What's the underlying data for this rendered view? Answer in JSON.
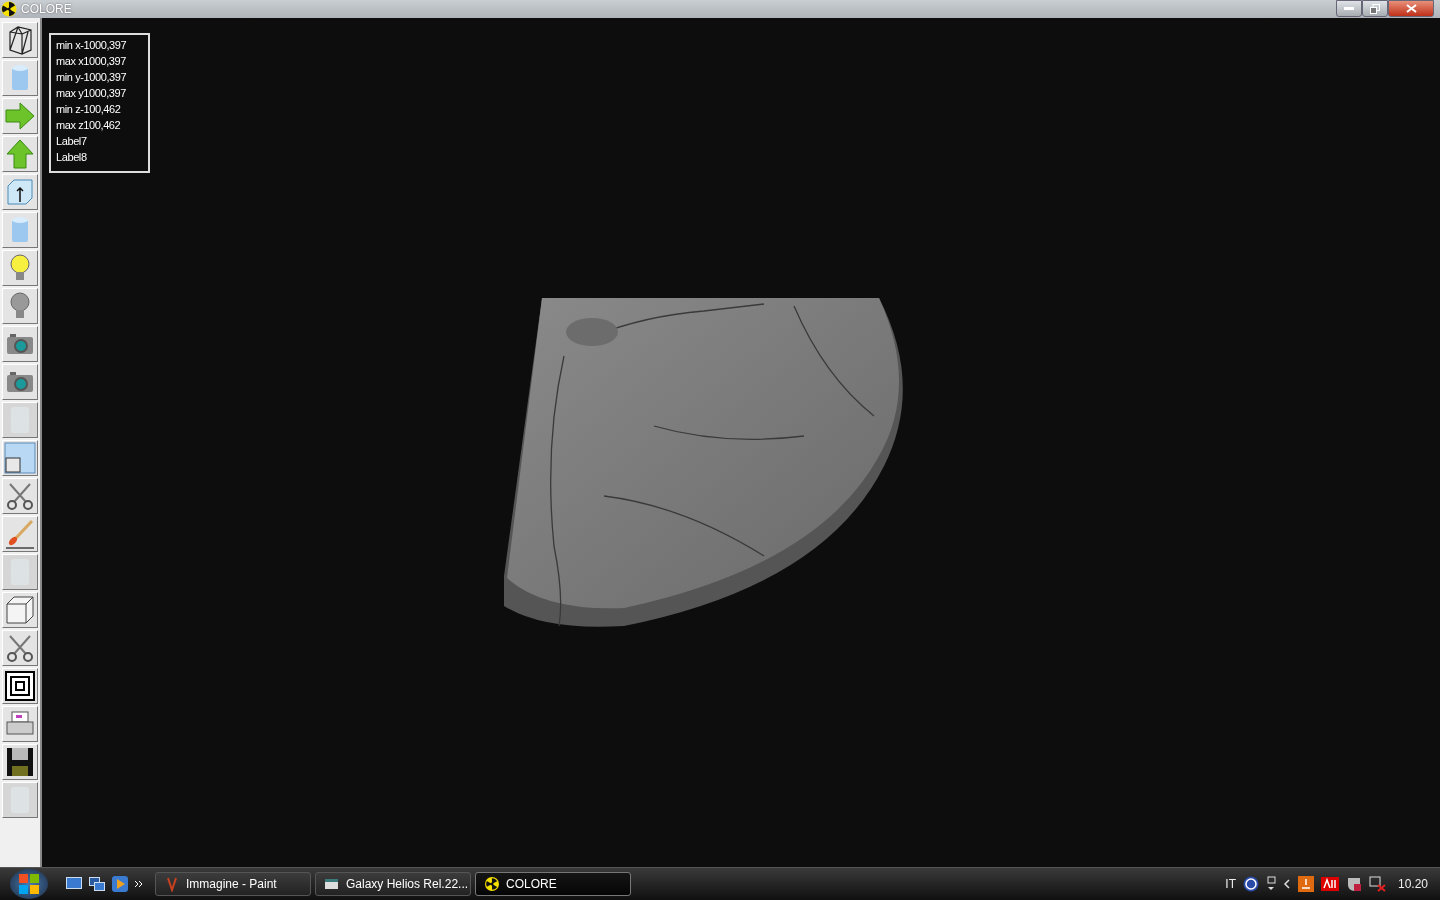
{
  "window": {
    "title": "COLORE"
  },
  "toolbar": [
    {
      "kind": "wireframe",
      "disabled": false
    },
    {
      "kind": "cylinder",
      "disabled": false
    },
    {
      "kind": "arrow-right",
      "disabled": false
    },
    {
      "kind": "arrow-up",
      "disabled": false
    },
    {
      "kind": "box-arrow",
      "disabled": false
    },
    {
      "kind": "cylinder",
      "disabled": false
    },
    {
      "kind": "bulb-on",
      "disabled": false
    },
    {
      "kind": "bulb-off",
      "disabled": false
    },
    {
      "kind": "camera",
      "disabled": false
    },
    {
      "kind": "camera",
      "disabled": false
    },
    {
      "kind": "blank",
      "disabled": true
    },
    {
      "kind": "squares",
      "disabled": false
    },
    {
      "kind": "scissors",
      "disabled": false
    },
    {
      "kind": "brush",
      "disabled": false
    },
    {
      "kind": "blank",
      "disabled": true
    },
    {
      "kind": "cube",
      "disabled": false
    },
    {
      "kind": "scissors",
      "disabled": false
    },
    {
      "kind": "concentric",
      "disabled": false
    },
    {
      "kind": "printer",
      "disabled": false
    },
    {
      "kind": "floppy",
      "disabled": false
    },
    {
      "kind": "blank",
      "disabled": true
    }
  ],
  "info_labels": [
    "min x-1000,397",
    "max x1000,397",
    "min y-1000,397",
    "max y1000,397",
    "min z-100,462",
    "max z100,462",
    "Label7",
    "Label8"
  ],
  "taskbar": {
    "tasks": [
      {
        "label": "Immagine - Paint",
        "selected": false
      },
      {
        "label": "Galaxy Helios  Rel.22...",
        "selected": false
      },
      {
        "label": "COLORE",
        "selected": true
      }
    ],
    "language": "IT",
    "clock": "10.20"
  }
}
